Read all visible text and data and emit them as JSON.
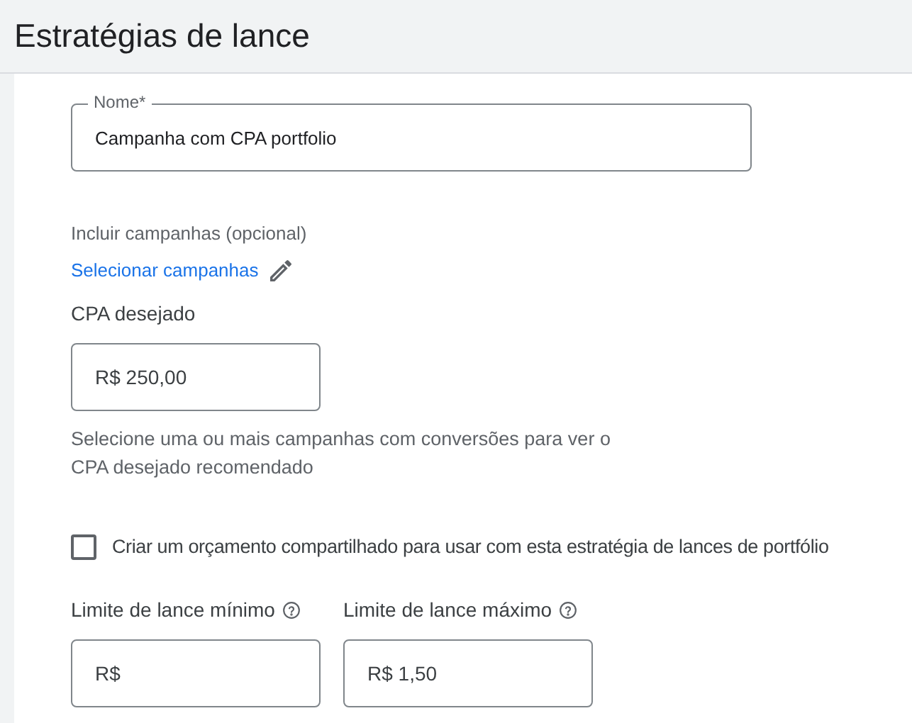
{
  "header": {
    "title": "Estratégias de lance"
  },
  "name_field": {
    "label": "Nome*",
    "value": "Campanha com CPA portfolio"
  },
  "include_campaigns": {
    "label": "Incluir campanhas (opcional)",
    "link": "Selecionar campanhas"
  },
  "target_cpa": {
    "label": "CPA desejado",
    "value": "R$ 250,00",
    "hint": "Selecione uma ou mais campanhas com conversões para ver o CPA desejado recomendado"
  },
  "shared_budget": {
    "label": "Criar um orçamento compartilhado para usar com esta estratégia de lances de portfólio",
    "checked": false
  },
  "bid_limits": [
    {
      "label": "Limite de lance mínimo",
      "value": "R$"
    },
    {
      "label": "Limite de lance máximo",
      "value": "R$ 1,50"
    }
  ]
}
